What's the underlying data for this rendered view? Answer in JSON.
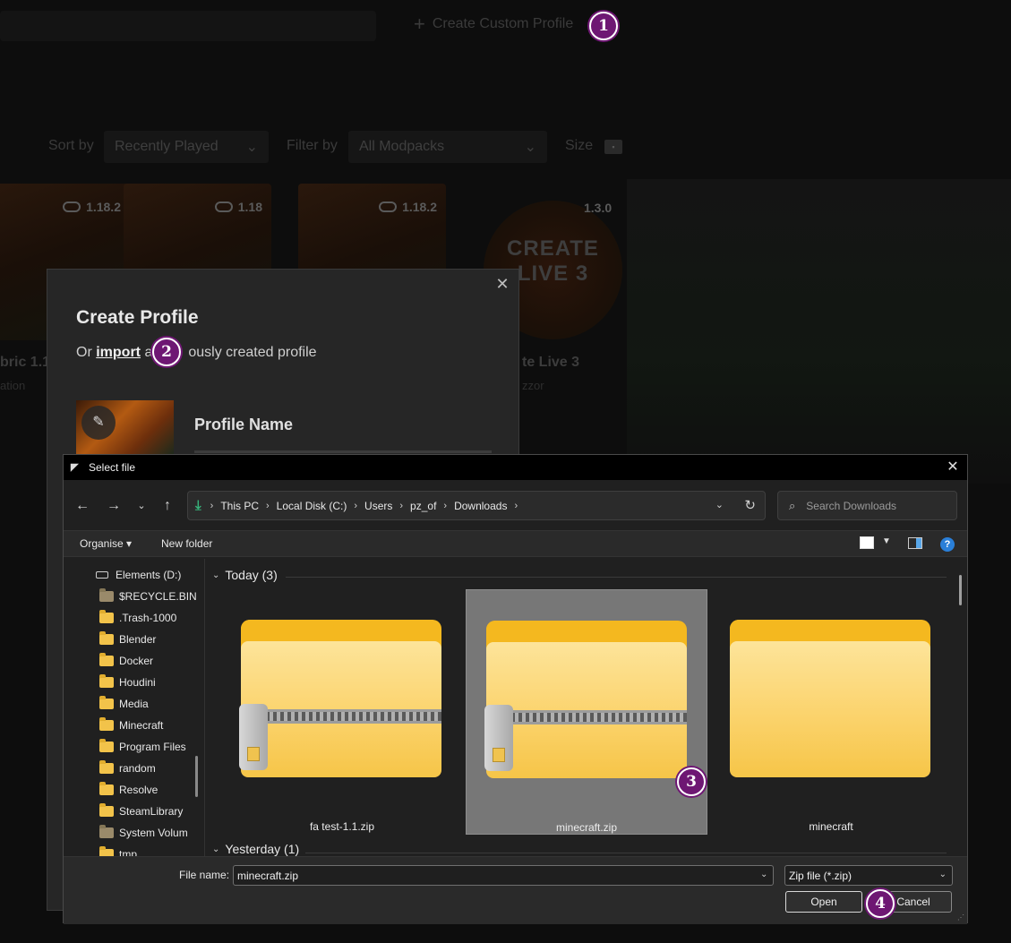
{
  "background": {
    "create_label": "Create Custom Profile",
    "sort_by_label": "Sort by",
    "sort_value": "Recently Played",
    "filter_by_label": "Filter by",
    "filter_value": "All Modpacks",
    "size_label": "Size",
    "cards": [
      {
        "version": "1.18.2"
      },
      {
        "version": "1.18"
      },
      {
        "version": "1.18.2"
      }
    ],
    "featured_card": {
      "version": "1.3.0",
      "art_text": "CREATE LIVE 3",
      "name_fragment": "te Live 3",
      "author_fragment": "zzor"
    },
    "left_card_name_fragment": "bric 1.1",
    "left_card_sub_fragment": "ation"
  },
  "modal": {
    "title": "Create Profile",
    "import_prefix": "Or",
    "import_link": "import",
    "import_suffix_a": "a",
    "import_suffix_b": "ously created profile",
    "profile_name_label": "Profile Name",
    "close_icon": "close-icon",
    "edit_icon": "pencil-icon"
  },
  "steps": [
    "1",
    "2",
    "3",
    "4"
  ],
  "dialog": {
    "title": "Select file",
    "breadcrumbs": [
      "This PC",
      "Local Disk (C:)",
      "Users",
      "pz_of",
      "Downloads"
    ],
    "search_placeholder": "Search Downloads",
    "toolbar": {
      "organise": "Organise",
      "new_folder": "New folder",
      "help": "?"
    },
    "tree": [
      {
        "label": "Elements (D:)",
        "type": "drive"
      },
      {
        "label": "$RECYCLE.BIN",
        "type": "folder-gray"
      },
      {
        "label": ".Trash-1000",
        "type": "folder"
      },
      {
        "label": "Blender",
        "type": "folder"
      },
      {
        "label": "Docker",
        "type": "folder"
      },
      {
        "label": "Houdini",
        "type": "folder"
      },
      {
        "label": "Media",
        "type": "folder"
      },
      {
        "label": "Minecraft",
        "type": "folder"
      },
      {
        "label": "Program Files",
        "type": "folder"
      },
      {
        "label": "random",
        "type": "folder"
      },
      {
        "label": "Resolve",
        "type": "folder"
      },
      {
        "label": "SteamLibrary",
        "type": "folder"
      },
      {
        "label": "System Volum",
        "type": "folder-gray"
      },
      {
        "label": "tmp",
        "type": "folder"
      }
    ],
    "groups": [
      {
        "label": "Today (3)"
      },
      {
        "label": "Yesterday (1)"
      }
    ],
    "files": [
      {
        "name": "fa test-1.1.zip",
        "kind": "zip",
        "selected": false
      },
      {
        "name": "minecraft.zip",
        "kind": "zip",
        "selected": true
      },
      {
        "name": "minecraft",
        "kind": "folder",
        "selected": false
      }
    ],
    "file_name_label": "File name:",
    "file_name_value": "minecraft.zip",
    "file_type_value": "Zip file (*.zip)",
    "open_label": "Open",
    "cancel_label": "Cancel"
  }
}
